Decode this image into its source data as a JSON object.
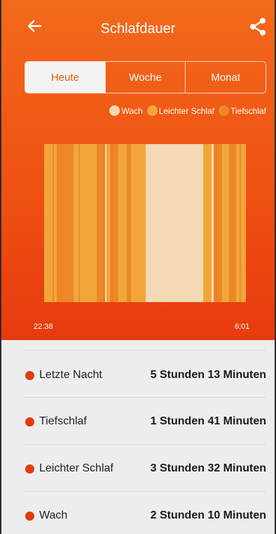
{
  "header": {
    "title": "Schlafdauer",
    "back_icon": "arrow-left-icon",
    "share_icon": "share-icon"
  },
  "tabs": [
    {
      "label": "Heute",
      "active": true
    },
    {
      "label": "Woche",
      "active": false
    },
    {
      "label": "Monat",
      "active": false
    }
  ],
  "legend": [
    {
      "label": "Wach",
      "color": "#f3d9b5"
    },
    {
      "label": "Leichter Schlaf",
      "color": "#f2a63a"
    },
    {
      "label": "Tiefschlaf",
      "color": "#ee8728"
    }
  ],
  "chart": {
    "start_time": "22:38",
    "end_time": "6:01"
  },
  "stats": [
    {
      "label": "Letzte Nacht",
      "value": "5 Stunden 13 Minuten"
    },
    {
      "label": "Tiefschlaf",
      "value": "1 Stunden 41 Minuten"
    },
    {
      "label": "Leichter Schlaf",
      "value": "3 Stunden 32 Minuten"
    },
    {
      "label": "Wach",
      "value": "2 Stunden 10 Minuten"
    }
  ],
  "colors": {
    "accent": "#ee5214",
    "stat_dot": "#e33a10"
  }
}
